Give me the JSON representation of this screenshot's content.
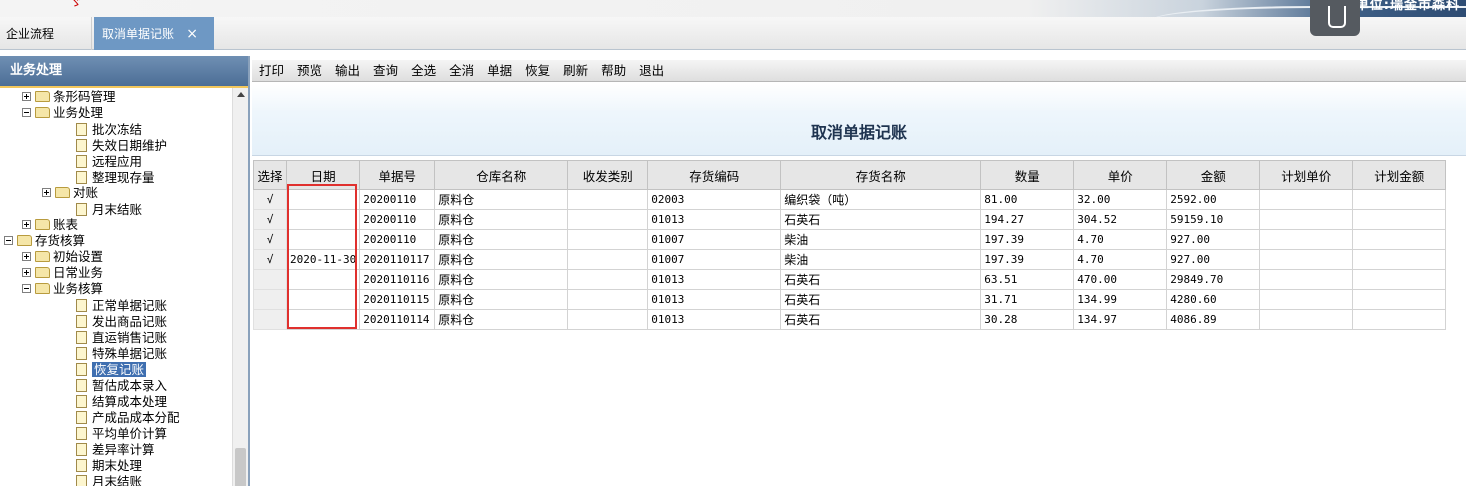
{
  "banner": {
    "left_mark": "ゞ",
    "unit_text": "单位:瑞金市森科"
  },
  "tabs": {
    "home": "企业流程",
    "active": "取消单据记账",
    "close": "×"
  },
  "sidebar": {
    "header": "业务处理",
    "items": [
      {
        "label": "条形码管理",
        "level": 1,
        "kind": "folder",
        "exp": "plus"
      },
      {
        "label": "业务处理",
        "level": 1,
        "kind": "folder",
        "exp": "minus"
      },
      {
        "label": "批次冻结",
        "level": 2,
        "kind": "doc"
      },
      {
        "label": "失效日期维护",
        "level": 2,
        "kind": "doc"
      },
      {
        "label": "远程应用",
        "level": 2,
        "kind": "doc"
      },
      {
        "label": "整理现存量",
        "level": 2,
        "kind": "doc"
      },
      {
        "label": "对账",
        "level": 2,
        "kind": "folder",
        "exp": "plus"
      },
      {
        "label": "月末结账",
        "level": 2,
        "kind": "doc"
      },
      {
        "label": "账表",
        "level": 1,
        "kind": "folder",
        "exp": "plus"
      },
      {
        "label": "存货核算",
        "level": 0,
        "kind": "folder",
        "exp": "minus"
      },
      {
        "label": "初始设置",
        "level": 1,
        "kind": "folder",
        "exp": "plus"
      },
      {
        "label": "日常业务",
        "level": 1,
        "kind": "folder",
        "exp": "plus"
      },
      {
        "label": "业务核算",
        "level": 1,
        "kind": "folder",
        "exp": "minus"
      },
      {
        "label": "正常单据记账",
        "level": 2,
        "kind": "doc"
      },
      {
        "label": "发出商品记账",
        "level": 2,
        "kind": "doc"
      },
      {
        "label": "直运销售记账",
        "level": 2,
        "kind": "doc"
      },
      {
        "label": "特殊单据记账",
        "level": 2,
        "kind": "doc"
      },
      {
        "label": "恢复记账",
        "level": 2,
        "kind": "doc",
        "selected": true
      },
      {
        "label": "暂估成本录入",
        "level": 2,
        "kind": "doc"
      },
      {
        "label": "结算成本处理",
        "level": 2,
        "kind": "doc"
      },
      {
        "label": "产成品成本分配",
        "level": 2,
        "kind": "doc"
      },
      {
        "label": "平均单价计算",
        "level": 2,
        "kind": "doc"
      },
      {
        "label": "差异率计算",
        "level": 2,
        "kind": "doc"
      },
      {
        "label": "期末处理",
        "level": 2,
        "kind": "doc"
      },
      {
        "label": "月末结账",
        "level": 2,
        "kind": "doc"
      }
    ]
  },
  "toolbar": [
    "打印",
    "预览",
    "输出",
    "查询",
    "全选",
    "全消",
    "单据",
    "恢复",
    "刷新",
    "帮助",
    "退出"
  ],
  "page_title": "取消单据记账",
  "table": {
    "columns": [
      "选择",
      "日期",
      "单据号",
      "仓库名称",
      "收发类别",
      "存货编码",
      "存货名称",
      "数量",
      "单价",
      "金额",
      "计划单价",
      "计划金额"
    ],
    "rows": [
      [
        "√",
        "",
        "20200110",
        "原料仓",
        "",
        "02003",
        "编织袋（吨）",
        "81.00",
        "32.00",
        "2592.00",
        "",
        ""
      ],
      [
        "√",
        "",
        "20200110",
        "原料仓",
        "",
        "01013",
        "石英石",
        "194.27",
        "304.52",
        "59159.10",
        "",
        ""
      ],
      [
        "√",
        "",
        "20200110",
        "原料仓",
        "",
        "01007",
        "柴油",
        "197.39",
        "4.70",
        "927.00",
        "",
        ""
      ],
      [
        "√",
        "2020-11-30",
        "2020110117",
        "原料仓",
        "",
        "01007",
        "柴油",
        "197.39",
        "4.70",
        "927.00",
        "",
        ""
      ],
      [
        "",
        "",
        "2020110116",
        "原料仓",
        "",
        "01013",
        "石英石",
        "63.51",
        "470.00",
        "29849.70",
        "",
        ""
      ],
      [
        "",
        "",
        "2020110115",
        "原料仓",
        "",
        "01013",
        "石英石",
        "31.71",
        "134.99",
        "4280.60",
        "",
        ""
      ],
      [
        "",
        "",
        "2020110114",
        "原料仓",
        "",
        "01013",
        "石英石",
        "30.28",
        "134.97",
        "4086.89",
        "",
        ""
      ]
    ]
  },
  "colors": {
    "tab_active": "#6e98c4",
    "sidebar_header": "#4c6e96",
    "highlight_box": "#e0302e",
    "selected_item": "#3f6fb0"
  }
}
